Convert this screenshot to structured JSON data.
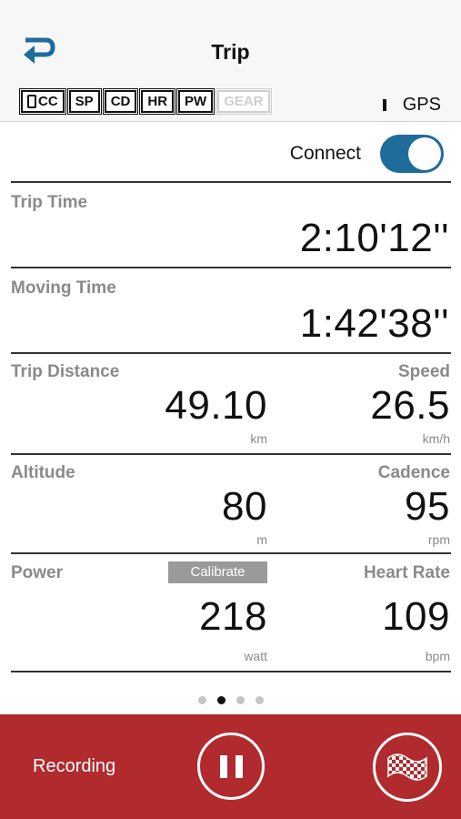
{
  "header": {
    "title": "Trip"
  },
  "sensors": [
    {
      "label": "CC",
      "has_phone": true,
      "enabled": true
    },
    {
      "label": "SP",
      "has_phone": false,
      "enabled": true
    },
    {
      "label": "CD",
      "has_phone": false,
      "enabled": true
    },
    {
      "label": "HR",
      "has_phone": false,
      "enabled": true
    },
    {
      "label": "PW",
      "has_phone": false,
      "enabled": true
    },
    {
      "label": "GEAR",
      "has_phone": false,
      "enabled": false
    }
  ],
  "gps": {
    "label": "GPS"
  },
  "connect": {
    "label": "Connect",
    "on": true
  },
  "trip_time": {
    "label": "Trip Time",
    "value": "2:10'12''"
  },
  "moving_time": {
    "label": "Moving Time",
    "value": "1:42'38''"
  },
  "trip_distance": {
    "label": "Trip Distance",
    "value": "49.10",
    "unit": "km"
  },
  "speed": {
    "label": "Speed",
    "value": "26.5",
    "unit": "km/h"
  },
  "altitude": {
    "label": "Altitude",
    "value": "80",
    "unit": "m"
  },
  "cadence": {
    "label": "Cadence",
    "value": "95",
    "unit": "rpm"
  },
  "power": {
    "label": "Power",
    "value": "218",
    "unit": "watt",
    "calibrate_label": "Calibrate"
  },
  "heart_rate": {
    "label": "Heart Rate",
    "value": "109",
    "unit": "bpm"
  },
  "pager": {
    "count": 4,
    "active_index": 1
  },
  "bottom": {
    "recording_label": "Recording"
  },
  "colors": {
    "accent": "#1f6c9b",
    "record_bar": "#b02a2e",
    "label_gray": "#8a8a8a"
  },
  "icons": {
    "back": "back-arrow-icon",
    "pause": "pause-icon",
    "finish": "checkered-flag-icon"
  }
}
